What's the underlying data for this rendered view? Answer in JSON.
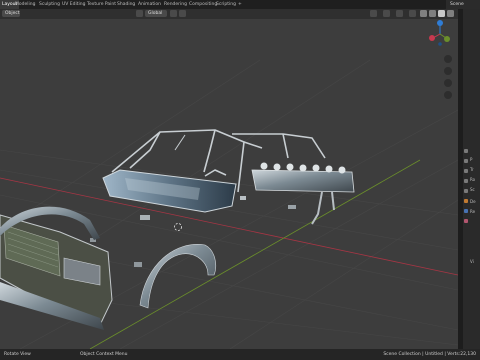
{
  "workspace_tabs": [
    "Layout",
    "Modeling",
    "Sculpting",
    "UV Editing",
    "Texture Paint",
    "Shading",
    "Animation",
    "Rendering",
    "Compositing",
    "Scripting"
  ],
  "scene_name": "Scene",
  "header": {
    "mode": "Object",
    "transform": "Global"
  },
  "status": {
    "left": "Rotate View",
    "mid": "Object Context Menu",
    "right": "Scene Collection | Untitled | Verts:22,130"
  },
  "properties_labels": [
    "P",
    "Tr",
    "Ro",
    "Sc",
    "De",
    "Re",
    "Vi"
  ],
  "colors": {
    "accent": "#4772b3",
    "x_axis": "#c7394f",
    "y_axis": "#6b8f2b",
    "z_axis": "#2f7dd6"
  }
}
